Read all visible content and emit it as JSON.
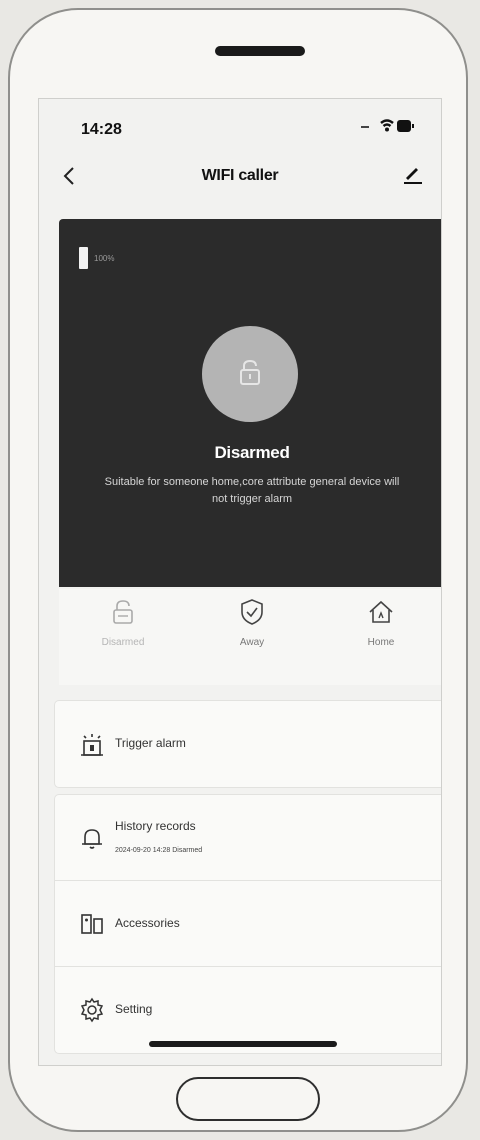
{
  "status_bar": {
    "time": "14:28"
  },
  "header": {
    "title": "WIFI caller"
  },
  "status_card": {
    "battery_text": "100%",
    "mode_title": "Disarmed",
    "mode_description": "Suitable for someone home,core attribute general device will not trigger alarm"
  },
  "modes": [
    {
      "label": "Disarmed",
      "icon": "lock-icon",
      "state": "selected"
    },
    {
      "label": "Away",
      "icon": "shield-icon"
    },
    {
      "label": "Home",
      "icon": "house-icon"
    }
  ],
  "menu": {
    "trigger_alarm": {
      "label": "Trigger alarm",
      "icon": "alarm-icon"
    },
    "history": {
      "label": "History records",
      "subtitle": "2024-09-20 14:28 Disarmed",
      "icon": "bell-icon"
    },
    "accessories": {
      "label": "Accessories",
      "icon": "accessories-icon"
    },
    "setting": {
      "label": "Setting",
      "icon": "gear-icon"
    }
  }
}
